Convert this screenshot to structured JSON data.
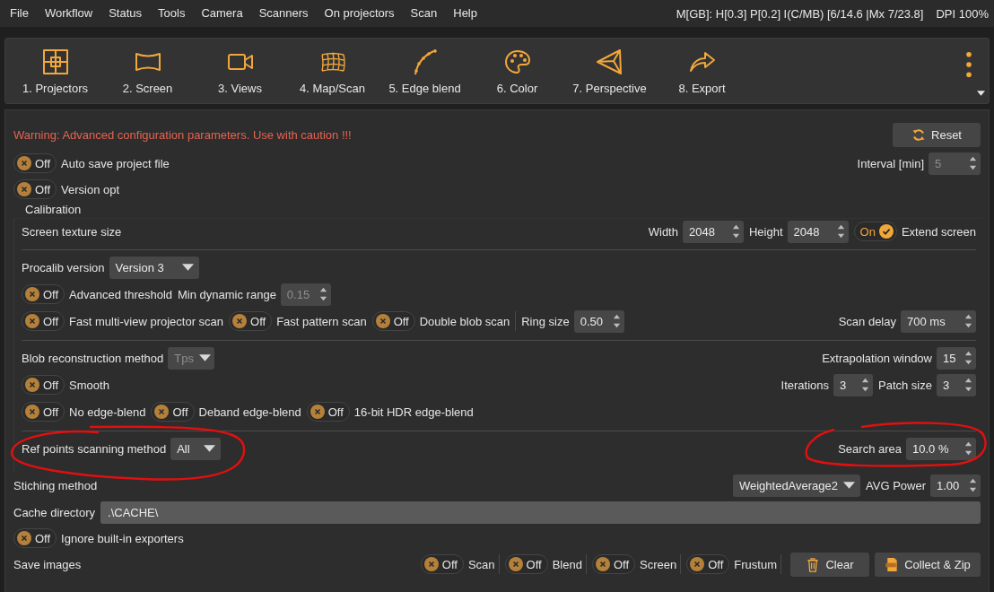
{
  "menu": [
    "File",
    "Workflow",
    "Status",
    "Tools",
    "Camera",
    "Scanners",
    "On projectors",
    "Scan",
    "Help"
  ],
  "memory_status": "M[GB]: H[0.3] P[0.2] I(C/MB) [6/14.6 |Mx 7/23.8]",
  "dpi": "DPI 100%",
  "toolbar": [
    {
      "label": "1. Projectors"
    },
    {
      "label": "2. Screen"
    },
    {
      "label": "3. Views"
    },
    {
      "label": "4. Map/Scan"
    },
    {
      "label": "5. Edge blend"
    },
    {
      "label": "6. Color"
    },
    {
      "label": "7. Perspective"
    },
    {
      "label": "8. Export"
    }
  ],
  "warning": "Warning: Advanced configuration parameters. Use with caution !!!",
  "reset_button": "Reset",
  "auto_save": {
    "text": "Off",
    "on": false,
    "label": "Auto save project file"
  },
  "interval": {
    "label": "Interval [min]",
    "value": "5",
    "disabled": true
  },
  "version_opt": {
    "text": "Off",
    "on": false,
    "label": "Version opt"
  },
  "calibration": {
    "title": "Calibration",
    "screen_texture_label": "Screen texture size",
    "width": {
      "label": "Width",
      "value": "2048",
      "disabled": false
    },
    "height": {
      "label": "Height",
      "value": "2048",
      "disabled": false
    },
    "extend_screen": {
      "text": "On",
      "on": true,
      "label": "Extend screen"
    },
    "procalib": {
      "label": "Procalib version",
      "value": "Version 3",
      "disabled": false
    },
    "advanced_threshold": {
      "text": "Off",
      "on": false,
      "label": "Advanced threshold"
    },
    "min_dynamic_range": {
      "label": "Min dynamic range",
      "value": "0.15",
      "disabled": true
    },
    "scan_toggles": [
      {
        "text": "Off",
        "on": false,
        "label": "Fast multi-view projector scan"
      },
      {
        "text": "Off",
        "on": false,
        "label": "Fast pattern scan"
      },
      {
        "text": "Off",
        "on": false,
        "label": "Double blob scan"
      }
    ],
    "ring_size": {
      "label": "Ring size",
      "value": "0.50",
      "disabled": false
    },
    "scan_delay": {
      "label": "Scan delay",
      "value": "700 ms",
      "disabled": false
    },
    "blob_method": {
      "label": "Blob reconstruction method",
      "value": "Tps",
      "disabled": true
    },
    "extrapolation_window": {
      "label": "Extrapolation window",
      "value": "15",
      "disabled": false
    },
    "smooth": {
      "text": "Off",
      "on": false,
      "label": "Smooth"
    },
    "iterations": {
      "label": "Iterations",
      "value": "3",
      "disabled": false
    },
    "patch_size": {
      "label": "Patch size",
      "value": "3",
      "disabled": false
    },
    "edge_toggles": [
      {
        "text": "Off",
        "on": false,
        "label": "No edge-blend"
      },
      {
        "text": "Off",
        "on": false,
        "label": "Deband edge-blend"
      },
      {
        "text": "Off",
        "on": false,
        "label": "16-bit HDR edge-blend"
      }
    ],
    "ref_points": {
      "label": "Ref points scanning method",
      "value": "All",
      "disabled": false
    },
    "search_area": {
      "label": "Search area",
      "value": "10.0 %",
      "disabled": false
    }
  },
  "stitching": {
    "label": "Stiching method",
    "value": "WeightedAverage2",
    "disabled": false
  },
  "avg_power": {
    "label": "AVG Power",
    "value": "1.00",
    "disabled": false
  },
  "cache": {
    "label": "Cache directory",
    "value": ".\\CACHE\\"
  },
  "ignore_exporters": {
    "text": "Off",
    "on": false,
    "label": "Ignore built-in exporters"
  },
  "save_images": {
    "label": "Save images",
    "toggles": [
      {
        "text": "Off",
        "on": false,
        "label": "Scan"
      },
      {
        "text": "Off",
        "on": false,
        "label": "Blend"
      },
      {
        "text": "Off",
        "on": false,
        "label": "Screen"
      },
      {
        "text": "Off",
        "on": false,
        "label": "Frustum"
      }
    ]
  },
  "clear_button": "Clear",
  "collect_button": "Collect & Zip"
}
